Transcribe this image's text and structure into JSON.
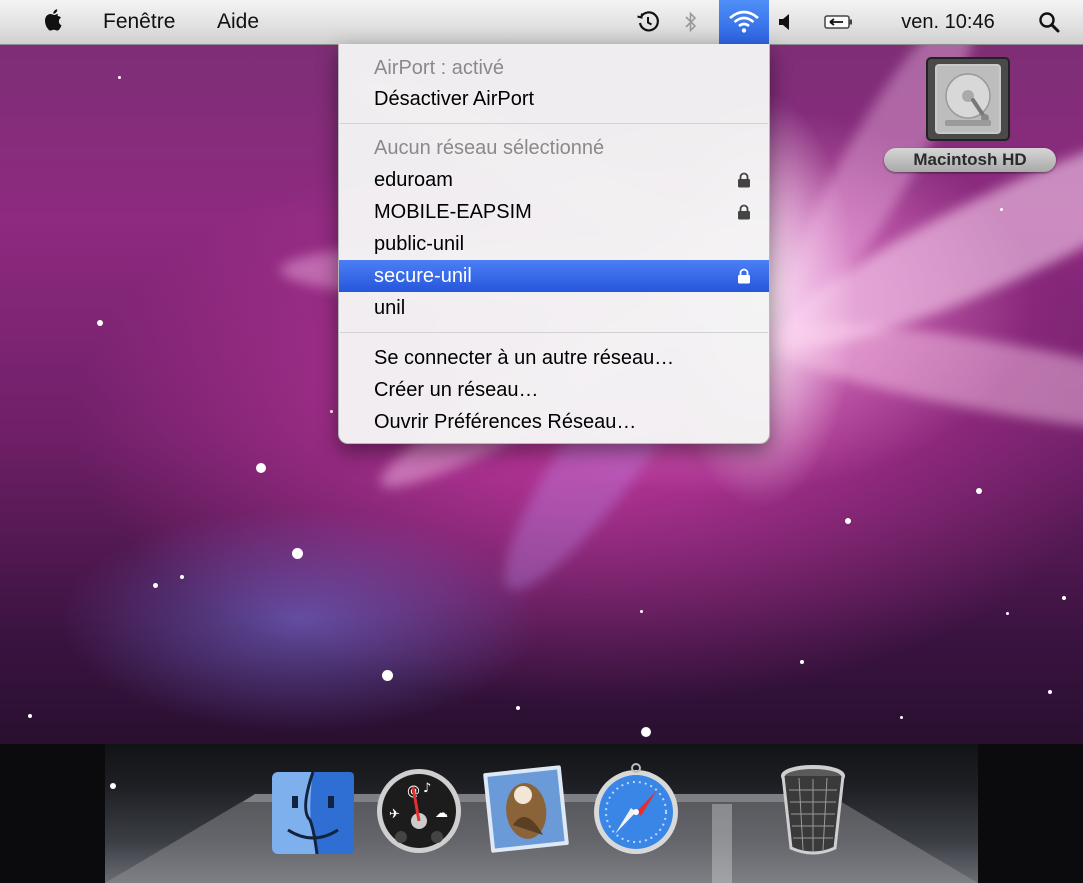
{
  "menubar": {
    "apple_icon": "apple-icon",
    "menus": [
      "Fenêtre",
      "Aide"
    ],
    "status_icons": [
      "time-machine-icon",
      "bluetooth-icon",
      "airport-wifi-icon",
      "volume-icon",
      "battery-icon",
      "spotlight-icon"
    ],
    "clock": "ven. 10:46"
  },
  "airport_menu": {
    "status": "AirPort : activé",
    "toggle": "Désactiver AirPort",
    "no_network": "Aucun réseau sélectionné",
    "networks": [
      {
        "name": "eduroam",
        "locked": true
      },
      {
        "name": "MOBILE-EAPSIM",
        "locked": true
      },
      {
        "name": "public-unil",
        "locked": false
      },
      {
        "name": "secure-unil",
        "locked": true,
        "highlighted": true
      },
      {
        "name": "unil",
        "locked": false
      }
    ],
    "actions": [
      "Se connecter à un autre réseau…",
      "Créer un réseau…",
      "Ouvrir Préférences Réseau…"
    ],
    "highlight_color": "#2f62e0"
  },
  "desktop": {
    "hd_label": "Macintosh HD"
  },
  "dock": {
    "items": [
      "finder-icon",
      "dashboard-icon",
      "mail-icon",
      "safari-icon",
      "trash-icon"
    ]
  }
}
